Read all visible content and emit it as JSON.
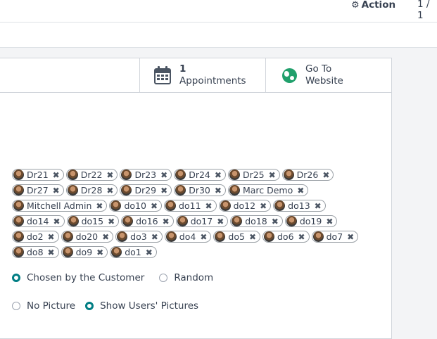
{
  "header": {
    "action_label": "Action",
    "action_icon": "gear-icon",
    "pager": "1 / 1"
  },
  "buttons": {
    "appointments_count": "1",
    "appointments_label": "Appointments",
    "appointments_icon": "calendar-icon",
    "website_line1": "Go To",
    "website_line2": "Website",
    "website_icon": "globe-icon"
  },
  "users": [
    "Dr21",
    "Dr22",
    "Dr23",
    "Dr24",
    "Dr25",
    "Dr26",
    "Dr27",
    "Dr28",
    "Dr29",
    "Dr30",
    "Marc Demo",
    "Mitchell Admin",
    "do10",
    "do11",
    "do12",
    "do13",
    "do14",
    "do15",
    "do16",
    "do17",
    "do18",
    "do19",
    "do2",
    "do20",
    "do3",
    "do4",
    "do5",
    "do6",
    "do7",
    "do8",
    "do9",
    "do1"
  ],
  "assignment": {
    "options": [
      "Chosen by the Customer",
      "Random"
    ],
    "selected": "Chosen by the Customer"
  },
  "picture": {
    "options": [
      "No Picture",
      "Show Users' Pictures"
    ],
    "selected": "Show Users' Pictures"
  },
  "colors": {
    "accent": "#017e84",
    "website": "#21a06c"
  }
}
